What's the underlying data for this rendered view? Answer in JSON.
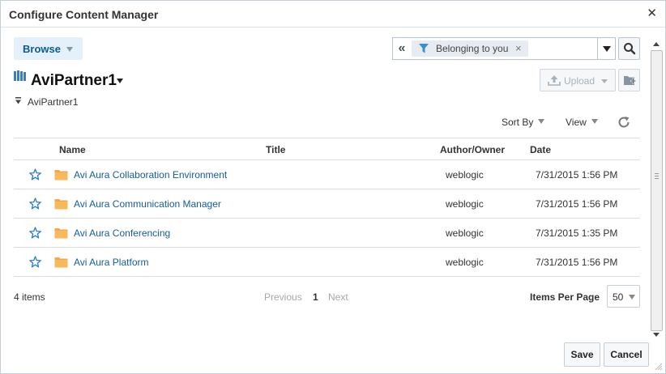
{
  "dialog": {
    "title": "Configure Content Manager",
    "close_label": "✕"
  },
  "toolbar": {
    "browse_label": "Browse",
    "collapse_label": "«",
    "filter_chip": "Belonging to you",
    "chip_remove_label": "×"
  },
  "library": {
    "name": "AviPartner1",
    "breadcrumb": "AviPartner1",
    "upload_label": "Upload"
  },
  "controls": {
    "sort_by": "Sort By",
    "view": "View"
  },
  "table": {
    "columns": [
      "Name",
      "Title",
      "Author/Owner",
      "Date"
    ],
    "rows": [
      {
        "name": "Avi Aura Collaboration Environment",
        "title": "",
        "owner": "weblogic",
        "date": "7/31/2015 1:56 PM"
      },
      {
        "name": "Avi Aura Communication Manager",
        "title": "",
        "owner": "weblogic",
        "date": "7/31/2015 1:56 PM"
      },
      {
        "name": "Avi Aura Conferencing",
        "title": "",
        "owner": "weblogic",
        "date": "7/31/2015 1:35 PM"
      },
      {
        "name": "Avi Aura Platform",
        "title": "",
        "owner": "weblogic",
        "date": "7/31/2015 1:56 PM"
      }
    ]
  },
  "pagination": {
    "count": "4 items",
    "previous": "Previous",
    "current_page": "1",
    "next": "Next",
    "items_per_page_label": "Items Per Page",
    "items_per_page_value": "50"
  },
  "footer": {
    "save_label": "Save",
    "cancel_label": "Cancel"
  },
  "colors": {
    "link": "#145c9e",
    "browse_bg": "#e4f1fb",
    "star": "#2a7fc9",
    "folder": "#f3a94a"
  }
}
